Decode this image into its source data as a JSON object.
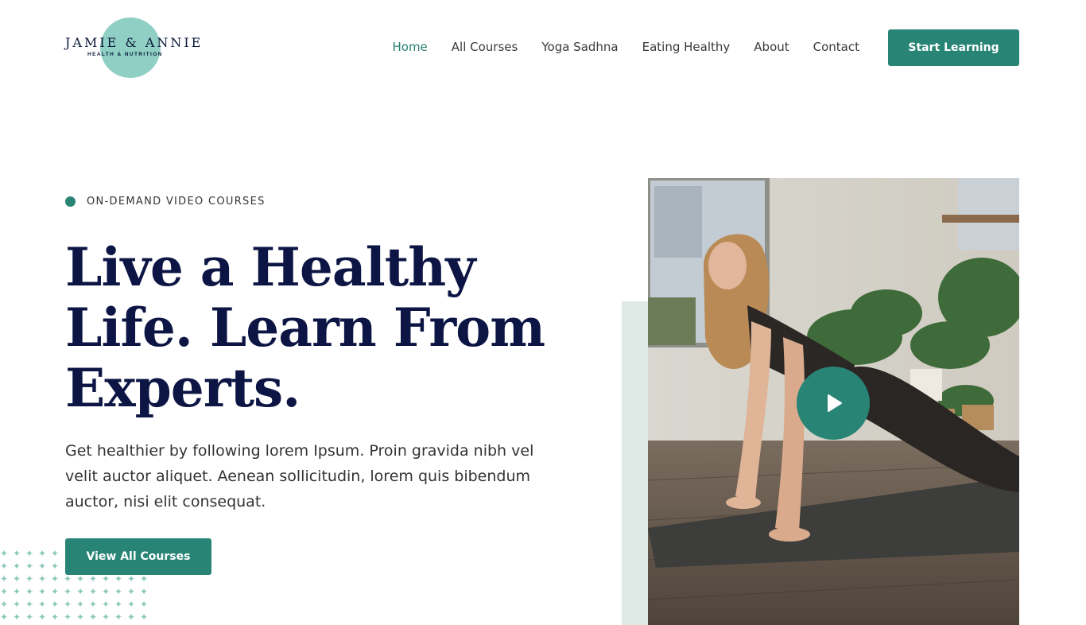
{
  "brand": {
    "name": "JAMIE & ANNIE",
    "tagline": "HEALTH & NUTRITION"
  },
  "nav": {
    "items": [
      {
        "label": "Home",
        "active": true
      },
      {
        "label": "All Courses",
        "active": false
      },
      {
        "label": "Yoga Sadhna",
        "active": false
      },
      {
        "label": "Eating Healthy",
        "active": false
      },
      {
        "label": "About",
        "active": false
      },
      {
        "label": "Contact",
        "active": false
      }
    ],
    "cta_label": "Start Learning"
  },
  "hero": {
    "eyebrow": "ON-DEMAND VIDEO COURSES",
    "headline": "Live a Healthy Life. Learn From Experts.",
    "lead": "Get healthier by following lorem Ipsum. Proin gravida nibh vel velit auctor aliquet. Aenean sollicitudin, lorem quis bibendum auctor, nisi elit consequat.",
    "cta_label": "View All Courses",
    "media": {
      "icon": "play-icon",
      "photo_subject": "woman-yoga-downward-dog-icon"
    }
  },
  "colors": {
    "accent": "#288575",
    "headline": "#0c1544",
    "logo_blob": "#8fcfc4",
    "panel": "#dfe9e6"
  }
}
